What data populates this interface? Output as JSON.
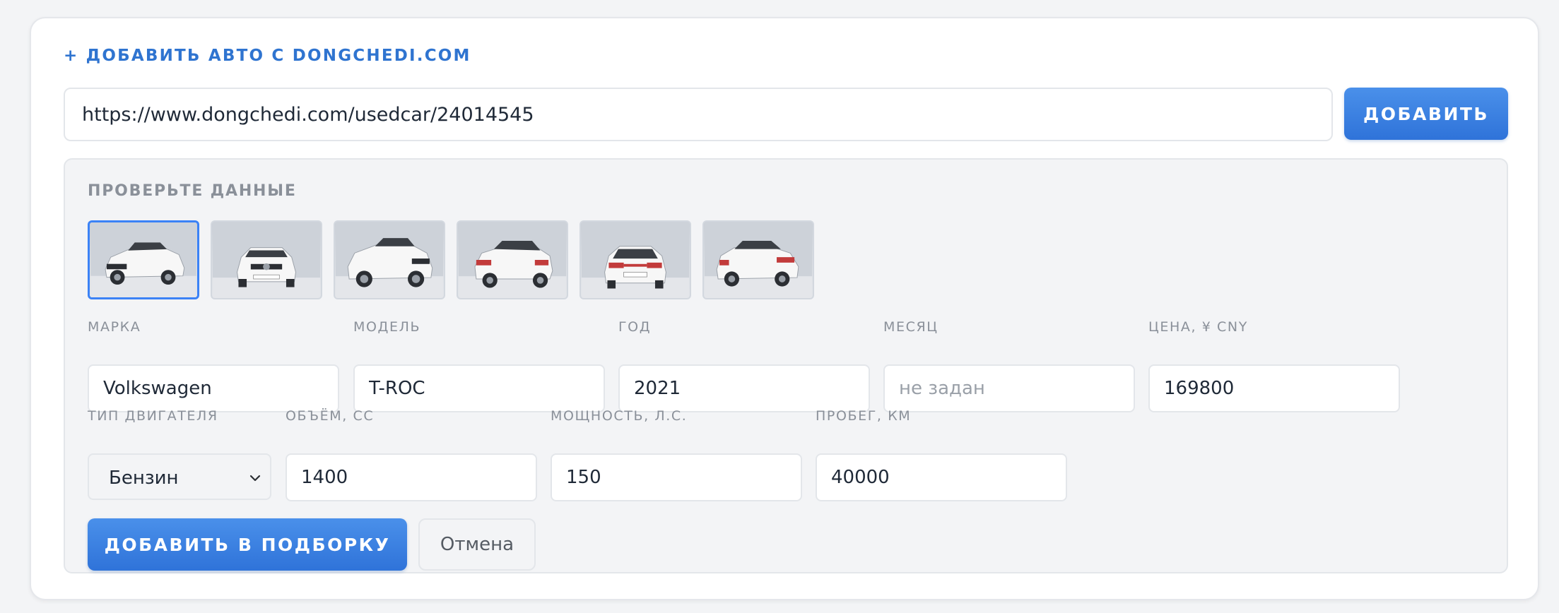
{
  "header": {
    "title": "+ ДОБАВИТЬ АВТО С DONGCHEDI.COM"
  },
  "url_form": {
    "value": "https://www.dongchedi.com/usedcar/24014545",
    "add_label": "ДОБАВИТЬ"
  },
  "review": {
    "title": "ПРОВЕРЬТЕ ДАННЫЕ",
    "photos": [
      {
        "view": "front-left",
        "selected": true
      },
      {
        "view": "front",
        "selected": false
      },
      {
        "view": "front-left",
        "selected": false
      },
      {
        "view": "rear-left",
        "selected": false
      },
      {
        "view": "rear",
        "selected": false
      },
      {
        "view": "rear-right",
        "selected": false
      }
    ],
    "fields": {
      "brand": {
        "label": "МАРКА",
        "value": "Volkswagen"
      },
      "model": {
        "label": "МОДЕЛЬ",
        "value": "T-ROC"
      },
      "year": {
        "label": "ГОД",
        "value": "2021"
      },
      "month": {
        "label": "МЕСЯЦ",
        "value": "",
        "placeholder": "не задан"
      },
      "price": {
        "label": "ЦЕНА, ¥ CNY",
        "value": "169800"
      },
      "engine_type": {
        "label": "ТИП ДВИГАТЕЛЯ",
        "value": "Бензин"
      },
      "volume": {
        "label": "ОБЪЁМ, СС",
        "value": "1400"
      },
      "power": {
        "label": "МОЩНОСТЬ, Л.С.",
        "value": "150"
      },
      "mileage": {
        "label": "ПРОБЕГ, КМ",
        "value": "40000"
      }
    },
    "submit_label": "ДОБАВИТЬ В ПОДБОРКУ",
    "cancel_label": "Отмена"
  },
  "colors": {
    "accent": "#2f74d0",
    "button": "#3a80e0",
    "selected_border": "#3b82f6"
  }
}
